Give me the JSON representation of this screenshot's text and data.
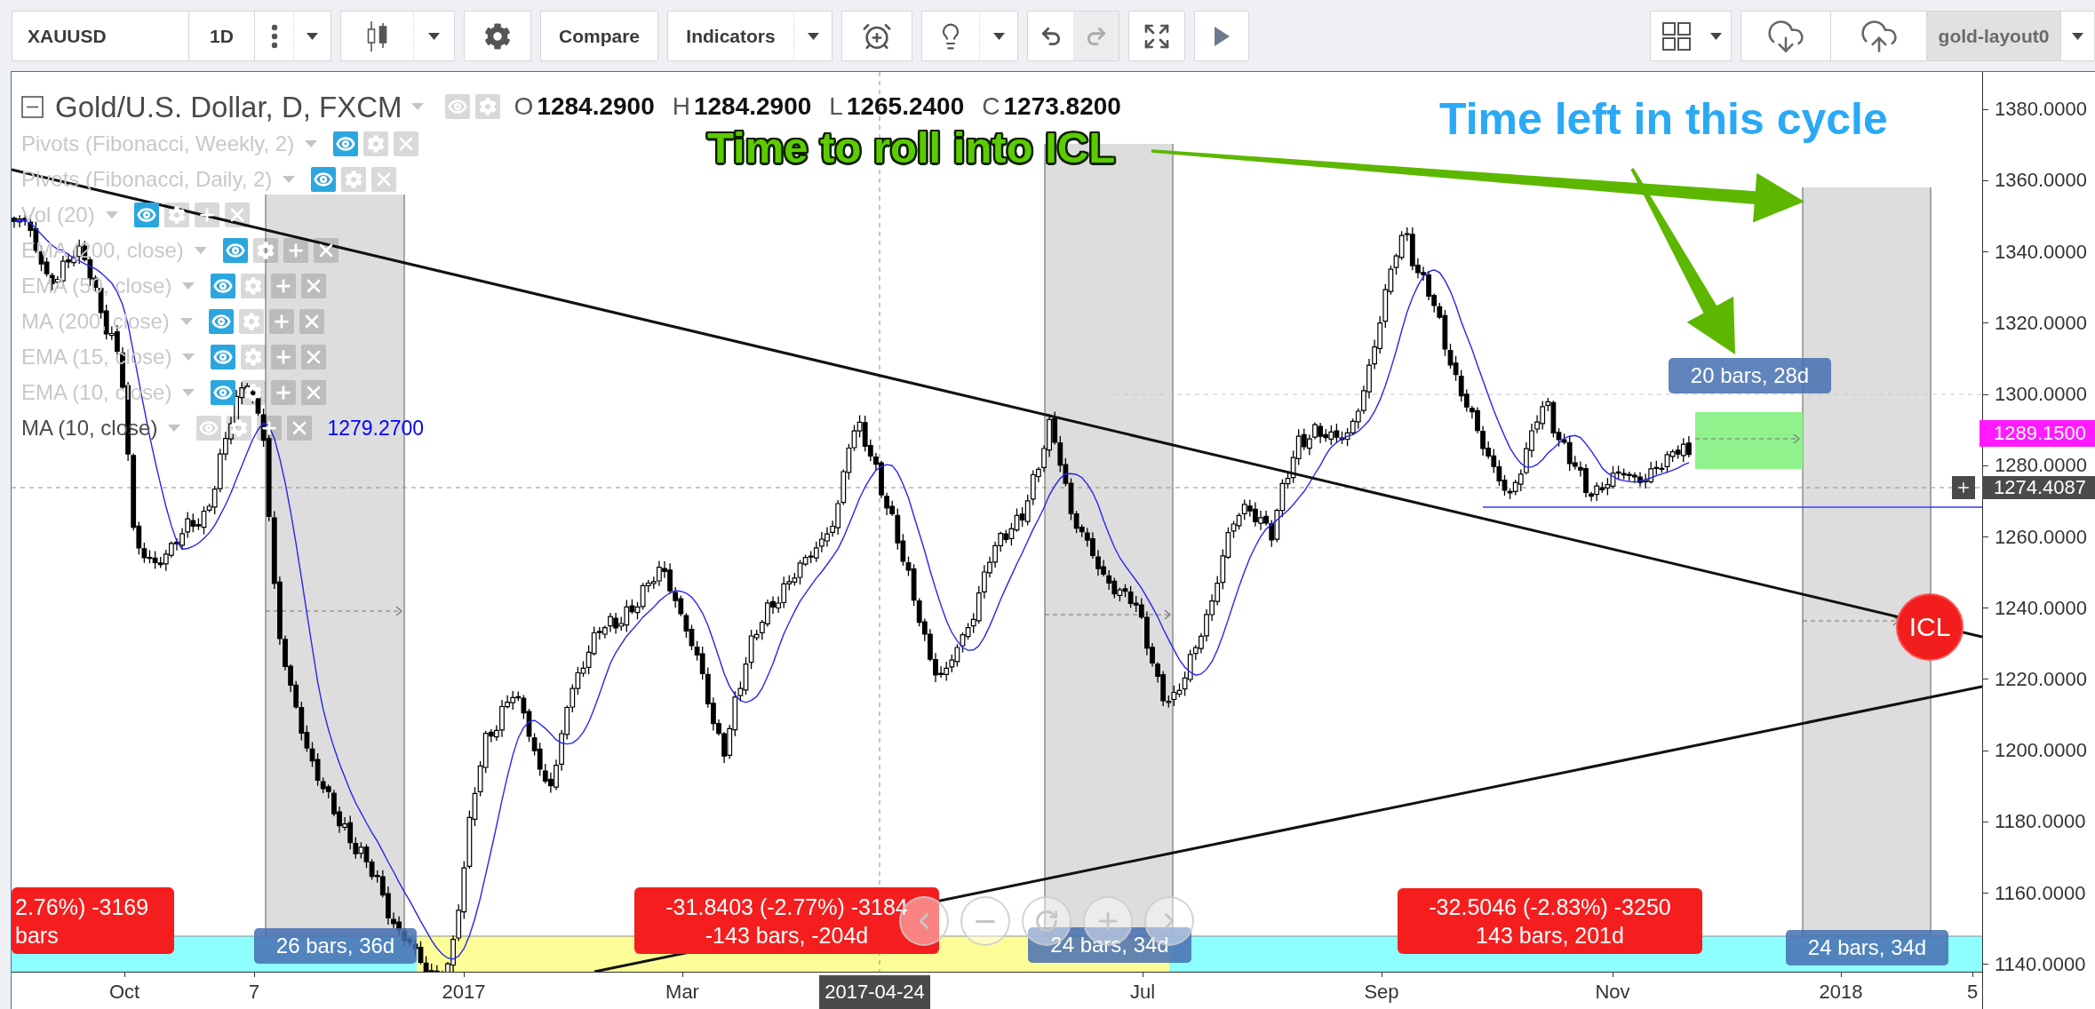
{
  "toolbar": {
    "symbol": "XAUUSD",
    "interval": "1D",
    "compare": "Compare",
    "indicators": "Indicators",
    "redo": {
      "disabled": true
    },
    "layout_name": "gold-layout0"
  },
  "legend": {
    "title": "Gold/U.S. Dollar, D, FXCM",
    "ohlc": [
      {
        "label": "O",
        "value": "1284.2900"
      },
      {
        "label": "H",
        "value": "1284.2900"
      },
      {
        "label": "L",
        "value": "1265.2400"
      },
      {
        "label": "C",
        "value": "1273.8200"
      }
    ],
    "indicators": [
      {
        "name": "Pivots (Fibonacci, Weekly, 2)",
        "hidden": true,
        "add_button": false
      },
      {
        "name": "Pivots (Fibonacci, Daily, 2)",
        "hidden": true,
        "add_button": false
      },
      {
        "name": "Vol (20)",
        "hidden": true,
        "add_button": true
      },
      {
        "name": "EMA (200, close)",
        "hidden": true,
        "add_button": true
      },
      {
        "name": "EMA (50, close)",
        "hidden": true,
        "add_button": true
      },
      {
        "name": "MA (200, close)",
        "hidden": true,
        "add_button": true
      },
      {
        "name": "EMA (15, close)",
        "hidden": true,
        "add_button": true
      },
      {
        "name": "EMA (10, close)",
        "hidden": true,
        "add_button": true
      },
      {
        "name": "MA (10, close)",
        "hidden": false,
        "add_button": true,
        "value": "1279.2700"
      }
    ]
  },
  "annotations": {
    "callouts": [
      {
        "kind": "outlined",
        "text": "Time to roll into ICL"
      },
      {
        "kind": "plain",
        "text": "Time left in this cycle"
      }
    ],
    "marker": "ICL",
    "bar_counts": [
      "20 bars, 28d",
      "26 bars, 36d",
      "24 bars, 34d",
      "24 bars, 34d"
    ],
    "range_labels": [
      {
        "line_1": "2.76%) -3169",
        "line_2": "bars"
      },
      {
        "line_1": "-31.8403 (-2.77%) -3184",
        "line_2": "-143 bars, -204d"
      },
      {
        "line_1": "-32.5046 (-2.83%) -3250",
        "line_2": "143 bars, 201d"
      }
    ]
  },
  "price_axis": {
    "labels": [
      "1380.0000",
      "1360.0000",
      "1340.0000",
      "1320.0000",
      "1300.0000",
      "1280.0000",
      "1260.0000",
      "1240.0000",
      "1220.0000",
      "1200.0000",
      "1180.0000",
      "1160.0000",
      "1140.0000"
    ],
    "last_price": "1289.1500",
    "crosshair_price": "1274.4087"
  },
  "time_axis": {
    "labels": [
      "Oct",
      "7",
      "2017",
      "Mar",
      "Jul",
      "Sep",
      "Nov",
      "2018",
      "5"
    ],
    "crosshair_date": "2017-04-24"
  }
}
